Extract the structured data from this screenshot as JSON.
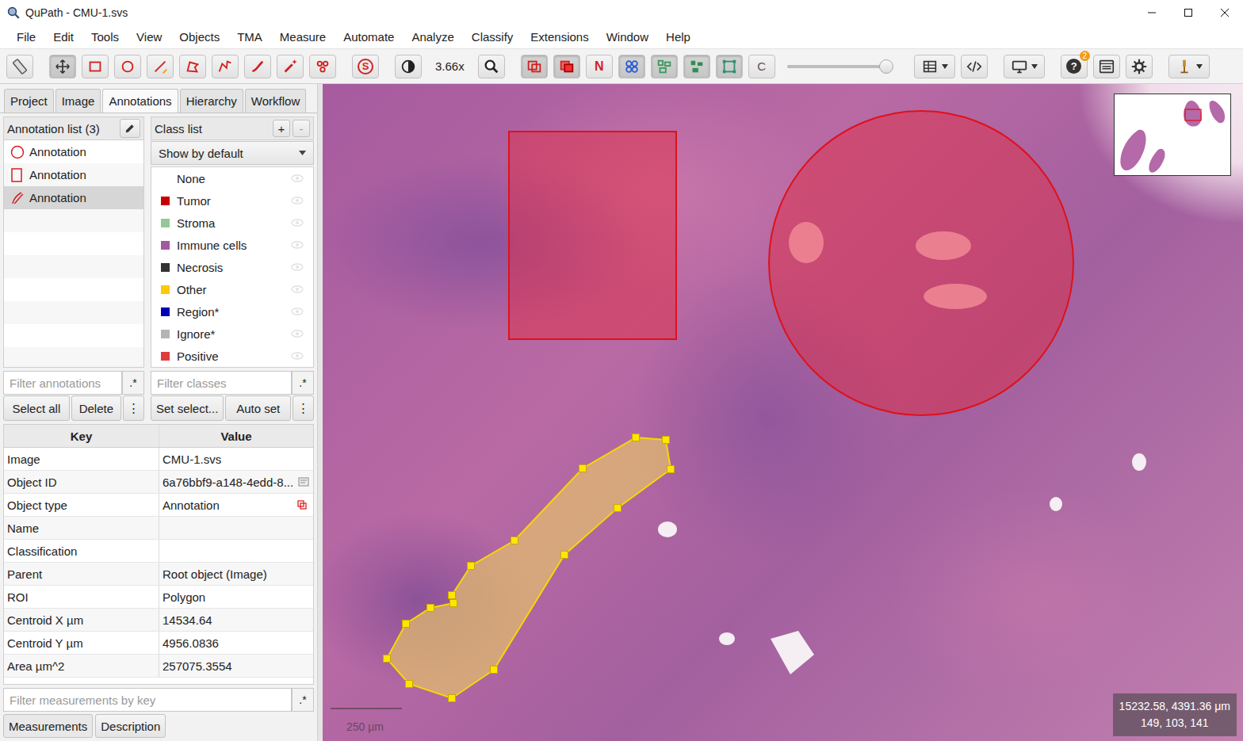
{
  "window": {
    "title": "QuPath - CMU-1.svs"
  },
  "menu": [
    "File",
    "Edit",
    "Tools",
    "View",
    "Objects",
    "TMA",
    "Measure",
    "Automate",
    "Analyze",
    "Classify",
    "Extensions",
    "Window",
    "Help"
  ],
  "toolbar": {
    "items": [
      {
        "kind": "ruler",
        "selected": false
      },
      {
        "kind": "separator"
      },
      {
        "kind": "move",
        "selected": true
      },
      {
        "kind": "rectangle",
        "selected": false
      },
      {
        "kind": "ellipse",
        "selected": false
      },
      {
        "kind": "line",
        "selected": false
      },
      {
        "kind": "polygon",
        "selected": false
      },
      {
        "kind": "polyline",
        "selected": false
      },
      {
        "kind": "brush",
        "selected": false
      },
      {
        "kind": "wand",
        "selected": false
      },
      {
        "kind": "points",
        "selected": false
      },
      {
        "kind": "separator"
      },
      {
        "kind": "selection-mode",
        "label": "S",
        "selected": false
      },
      {
        "kind": "separator"
      },
      {
        "kind": "contrast",
        "selected": false
      },
      {
        "kind": "zoom-text",
        "label": "3.66x"
      },
      {
        "kind": "zoom-fit",
        "selected": false
      },
      {
        "kind": "separator"
      },
      {
        "kind": "show-annotations",
        "selected": true
      },
      {
        "kind": "fill-annotations",
        "selected": true
      },
      {
        "kind": "show-names",
        "label": "N",
        "selected": false
      },
      {
        "kind": "tma-grid",
        "selected": true
      },
      {
        "kind": "detections",
        "selected": true
      },
      {
        "kind": "fill-detections",
        "selected": true
      },
      {
        "kind": "pixel-classification",
        "selected": true
      },
      {
        "kind": "convolution",
        "label": "C",
        "selected": false
      },
      {
        "kind": "slider",
        "level": 0.95
      },
      {
        "kind": "separator"
      },
      {
        "kind": "table-view",
        "selected": false
      },
      {
        "kind": "script",
        "selected": false
      },
      {
        "kind": "separator"
      },
      {
        "kind": "display",
        "selected": false
      },
      {
        "kind": "separator"
      },
      {
        "kind": "help",
        "label": "?",
        "badge": "2",
        "selected": false
      },
      {
        "kind": "log",
        "selected": false
      },
      {
        "kind": "settings",
        "selected": false
      },
      {
        "kind": "separator"
      },
      {
        "kind": "extensions",
        "selected": false
      }
    ]
  },
  "left_tabs": [
    {
      "label": "Project",
      "selected": false
    },
    {
      "label": "Image",
      "selected": false
    },
    {
      "label": "Annotations",
      "selected": true
    },
    {
      "label": "Hierarchy",
      "selected": false
    },
    {
      "label": "Workflow",
      "selected": false
    }
  ],
  "annotation_list": {
    "title": "Annotation list (3)",
    "items": [
      {
        "label": "Annotation",
        "kind": "ellipse",
        "selected": false
      },
      {
        "label": "Annotation",
        "kind": "rectangle",
        "selected": false
      },
      {
        "label": "Annotation",
        "kind": "polyline",
        "selected": true
      }
    ],
    "filter_placeholder": "Filter annotations",
    "regex": ".*",
    "buttons": [
      "Select all",
      "Delete"
    ],
    "more": "⋮"
  },
  "class_list": {
    "title": "Class list",
    "add": "+",
    "remove": "-",
    "display": "Show by default",
    "items": [
      {
        "name": "None",
        "color": "#ffffff"
      },
      {
        "name": "Tumor",
        "color": "#c80000"
      },
      {
        "name": "Stroma",
        "color": "#96c896"
      },
      {
        "name": "Immune cells",
        "color": "#a05aa0"
      },
      {
        "name": "Necrosis",
        "color": "#323232"
      },
      {
        "name": "Other",
        "color": "#ffc800"
      },
      {
        "name": "Region*",
        "color": "#0000b4"
      },
      {
        "name": "Ignore*",
        "color": "#b4b4b4"
      },
      {
        "name": "Positive",
        "color": "#e03c3c"
      }
    ],
    "filter_placeholder": "Filter classes",
    "regex": ".*",
    "buttons": [
      "Set select...",
      "Auto set"
    ],
    "more": "⋮"
  },
  "properties": {
    "columns": [
      "Key",
      "Value"
    ],
    "rows": [
      {
        "key": "Image",
        "value": "CMU-1.svs",
        "kind": "plain"
      },
      {
        "key": "Object ID",
        "value": "6a76bbf9-a148-4edd-8...",
        "kind": "copyable"
      },
      {
        "key": "Object type",
        "value": "Annotation",
        "kind": "object-type"
      },
      {
        "key": "Name",
        "value": "",
        "kind": "plain"
      },
      {
        "key": "Classification",
        "value": "",
        "kind": "plain"
      },
      {
        "key": "Parent",
        "value": "Root object (Image)",
        "kind": "plain"
      },
      {
        "key": "ROI",
        "value": "Polygon",
        "kind": "plain"
      },
      {
        "key": "Centroid X µm",
        "value": "14534.64",
        "kind": "plain"
      },
      {
        "key": "Centroid Y µm",
        "value": "4956.0836",
        "kind": "plain"
      },
      {
        "key": "Area µm^2",
        "value": "257075.3554",
        "kind": "plain"
      }
    ],
    "filter_placeholder": "Filter measurements by key",
    "regex": ".*"
  },
  "bottom_tabs": [
    {
      "label": "Measurements",
      "selected": true
    },
    {
      "label": "Description",
      "selected": false
    }
  ],
  "viewer": {
    "scale_bar": "250 µm",
    "cursor": "15232.58, 4391.36 μm",
    "pixel": "149, 103, 141"
  }
}
